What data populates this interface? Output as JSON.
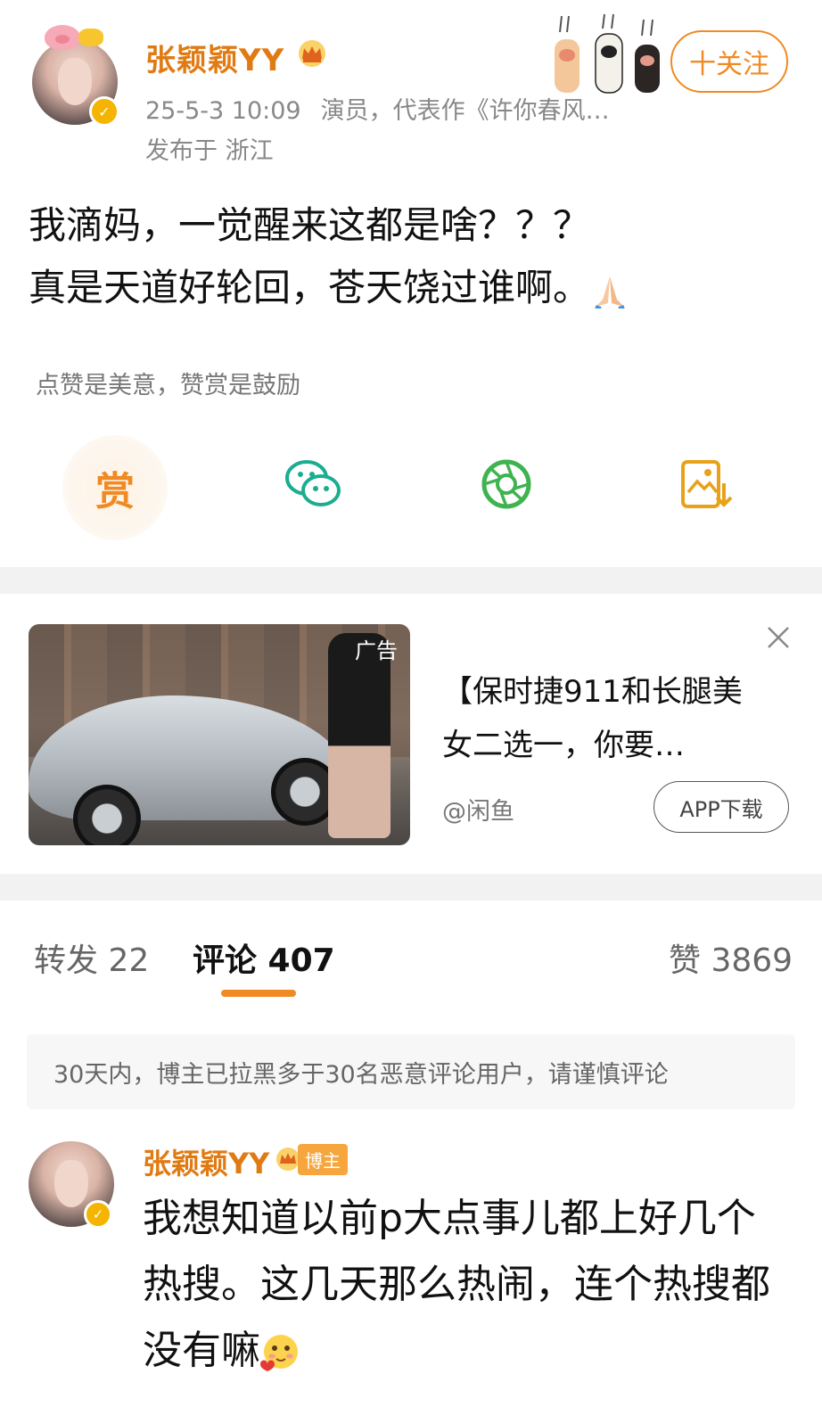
{
  "post": {
    "username": "张颖颖YY",
    "timestamp": "25-5-3 10:09",
    "role": "演员，代表作《许你春风…",
    "location": "发布于 浙江",
    "follow_label": "十关注",
    "text_line1": "我滴妈，一觉醒来这都是啥？？？",
    "text_line2": "真是天道好轮回，苍天饶过谁啊。",
    "reward_hint": "点赞是美意，赞赏是鼓励",
    "reward_label": "赏"
  },
  "ad": {
    "label": "广告",
    "title": "【保时捷911和长腿美女二选一，你要…",
    "source": "@闲鱼",
    "button": "APP下载"
  },
  "tabs": {
    "repost": "转发 22",
    "comments": "评论 407",
    "likes": "赞 3869"
  },
  "notice": "30天内，博主已拉黑多于30名恶意评论用户，请谨慎评论",
  "comment": {
    "username": "张颖颖YY",
    "badge": "博主",
    "text": "我想知道以前p大点事儿都上好几个热搜。这几天那么热闹，连个热搜都没有嘛"
  },
  "colors": {
    "accent": "#f08a24",
    "username": "#e07b14",
    "wechat": "#1aad8f",
    "moments": "#3fb34f"
  },
  "icons": [
    "wechat-icon",
    "moments-icon",
    "save-image-icon",
    "close-icon",
    "crown-icon",
    "verified-icon",
    "pray-emoji",
    "blush-emoji",
    "cat-paws-icon"
  ]
}
